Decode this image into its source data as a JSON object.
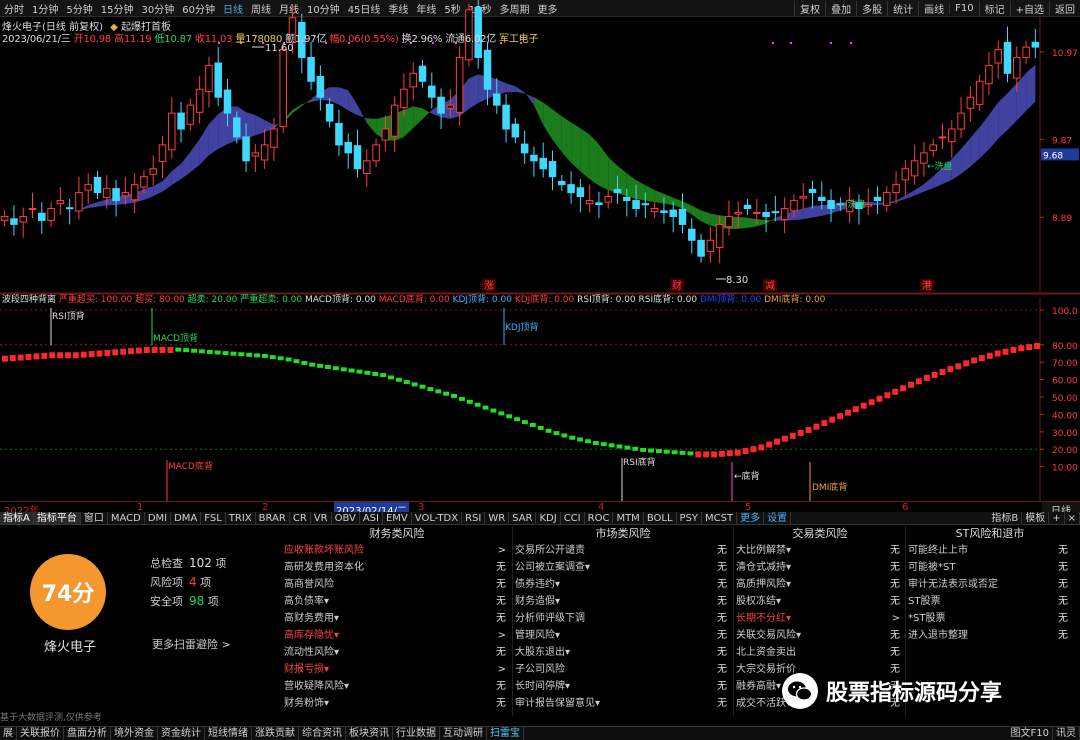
{
  "toolbar": {
    "periods": [
      "分时",
      "1分钟",
      "5分钟",
      "15分钟",
      "30分钟",
      "60分钟",
      "日线",
      "周线",
      "月线",
      "10分钟",
      "45日线",
      "季线",
      "年线",
      "5秒",
      "15秒",
      "多周期",
      "更多"
    ],
    "active_period": "日线",
    "right": [
      "复权",
      "叠加",
      "多股",
      "统计",
      "画线",
      "F10",
      "标记",
      "+自选",
      "返回"
    ]
  },
  "stock": {
    "name": "烽火电子(日线 前复权)",
    "tag": "起爆打首板",
    "date": "2023/06/21/三",
    "open_label": "开",
    "open": "10.98",
    "high_label": "高",
    "high": "11.19",
    "low_label": "低",
    "low": "10.87",
    "close_label": "收",
    "close": "11.03",
    "vol_label": "量",
    "vol": "178080",
    "amount_label": "额",
    "amount": "1.97亿",
    "change_label": "幅",
    "change": "0.06(0.55%)",
    "turn_label": "换",
    "turn": "2.96%",
    "float_label": "流通",
    "float": "6.02亿",
    "sector": "军工电子"
  },
  "price_axis": {
    "labels": [
      "10.97",
      "9.87",
      "8.89"
    ],
    "current": "9.68"
  },
  "chart_labels": {
    "high": "11.60",
    "low": "8.30",
    "wash1": "←洗盘",
    "wash2": "←洗盘"
  },
  "event_tags": [
    "涨",
    "财",
    "减",
    "港"
  ],
  "indicator": {
    "title": "波段四种背离",
    "items": [
      {
        "l": "严重超买:",
        "v": "100.00",
        "c": "#ff3c3c"
      },
      {
        "l": "超买:",
        "v": "80.00",
        "c": "#ff3c3c"
      },
      {
        "l": "超卖:",
        "v": "20.00",
        "c": "#20d860"
      },
      {
        "l": "严重超卖:",
        "v": "0.00",
        "c": "#20d860"
      },
      {
        "l": "MACD顶背:",
        "v": "0.00",
        "c": "#ddd"
      },
      {
        "l": "MACD底背:",
        "v": "0.00",
        "c": "#ff3c3c"
      },
      {
        "l": "KDJ顶背:",
        "v": "0.00",
        "c": "#40b0ff"
      },
      {
        "l": "KDJ底背:",
        "v": "0.00",
        "c": "#ff3c3c"
      },
      {
        "l": "RSI顶背:",
        "v": "0.00",
        "c": "#ddd"
      },
      {
        "l": "RSI底背:",
        "v": "0.00",
        "c": "#ddd"
      },
      {
        "l": "DMI顶背:",
        "v": "0.00",
        "c": "#2040ff"
      },
      {
        "l": "DMI底背:",
        "v": "0.00",
        "c": "#e8a040"
      }
    ],
    "axis": [
      "100.0",
      "80.00",
      "70.00",
      "60.00",
      "50.00",
      "40.00",
      "30.00",
      "20.00",
      "10.00"
    ],
    "labels": {
      "rsi_top": "RSI顶背",
      "macd_top": "MACD顶背",
      "kdj_top": "KDJ顶背",
      "macd_bot": "MACD底背",
      "rsi_bot": "RSI底背",
      "sup_bot": "←底背",
      "dmi_bot": "DMI底背"
    }
  },
  "dates": {
    "year": "2022年",
    "m2": "2",
    "m3": "3",
    "m4": "4",
    "m5": "5",
    "m6": "6",
    "m1": "1",
    "selected": "2023/02/14/二",
    "day": "日线"
  },
  "indtabs": [
    "指标A",
    "指标平台",
    "窗口",
    "MACD",
    "DMI",
    "DMA",
    "FSL",
    "TRIX",
    "BRAR",
    "CR",
    "VR",
    "OBV",
    "ASI",
    "EMV",
    "VOL-TDX",
    "RSI",
    "WR",
    "SAR",
    "KDJ",
    "CCI",
    "ROC",
    "MTM",
    "BOLL",
    "PSY",
    "MCST",
    "更多",
    "设置"
  ],
  "indtabs_right": [
    "指标B",
    "模板",
    "+",
    "×"
  ],
  "risk": {
    "score": "74分",
    "company": "烽火电子",
    "total_label": "总检查",
    "total": "102",
    "total_unit": "项",
    "risk_label": "风险项",
    "risk": "4",
    "risk_unit": "项",
    "safe_label": "安全项",
    "safe": "98",
    "safe_unit": "项",
    "more": "更多扫雷避险 >",
    "columns": [
      {
        "title": "财务类风险",
        "rows": [
          [
            "应收账款坏账风险",
            ">",
            1
          ],
          [
            "高研发费用资本化",
            "无",
            0
          ],
          [
            "高商誉风险",
            "无",
            0
          ],
          [
            "高负债率▾",
            "无",
            0
          ],
          [
            "高财务费用▾",
            "无",
            0
          ],
          [
            "高库存隐忧▾",
            ">",
            1
          ],
          [
            "流动性风险▾",
            "无",
            0
          ],
          [
            "财报亏损▾",
            ">",
            1
          ],
          [
            "营收疑降风险▾",
            "无",
            0
          ],
          [
            "财务粉饰▾",
            "无",
            0
          ]
        ]
      },
      {
        "title": "市场类风险",
        "rows": [
          [
            "交易所公开谴责",
            "无",
            0
          ],
          [
            "公司被立案调查▾",
            "无",
            0
          ],
          [
            "债券违约▾",
            "无",
            0
          ],
          [
            "财务造假▾",
            "无",
            0
          ],
          [
            "分析师评级下调",
            "无",
            0
          ],
          [
            "管理风险▾",
            "无",
            0
          ],
          [
            "大股东退出▾",
            "无",
            0
          ],
          [
            "子公司风险",
            "无",
            0
          ],
          [
            "长时间停牌▾",
            "无",
            0
          ],
          [
            "审计报告保留意见▾",
            "无",
            0
          ]
        ]
      },
      {
        "title": "交易类风险",
        "rows": [
          [
            "大比例解禁▾",
            "无",
            0
          ],
          [
            "清仓式减持▾",
            "无",
            0
          ],
          [
            "高质押风险▾",
            "无",
            0
          ],
          [
            "股权冻结▾",
            "无",
            0
          ],
          [
            "长期不分红▾",
            ">",
            1
          ],
          [
            "关联交易风险▾",
            "无",
            0
          ],
          [
            "北上资金卖出",
            "无",
            0
          ],
          [
            "大宗交易折价",
            "无",
            0
          ],
          [
            "融券高融▾",
            "无",
            0
          ],
          [
            "成交不活跃▾",
            "无",
            0
          ]
        ]
      },
      {
        "title": "ST风险和退市",
        "rows": [
          [
            "可能终止上市",
            "无",
            0
          ],
          [
            "可能被*ST",
            "无",
            0
          ],
          [
            "审计无法表示或否定",
            "无",
            0
          ],
          [
            "ST股票",
            "无",
            0
          ],
          [
            "*ST股票",
            "无",
            0
          ],
          [
            "进入退市整理",
            "无",
            0
          ]
        ]
      }
    ],
    "note": "基于大数据评测,仅供参考"
  },
  "bottom": {
    "tabs": [
      "展",
      "关联报价",
      "盘面分析",
      "境外资金",
      "资金统计",
      "短线情绪",
      "涨跌贡献",
      "综合资讯",
      "板块资讯",
      "行业数据",
      "互动调研",
      "扫雷宝"
    ],
    "active": "扫雷宝",
    "right": [
      "图文F10",
      "讯灵"
    ]
  },
  "watermark": "股票指标源码分享",
  "chart_data": {
    "type": "candlestick",
    "price_axis_labels": [
      10.97,
      9.87,
      8.89
    ],
    "current_price": 9.68,
    "period_high": 11.6,
    "period_low": 8.3,
    "indicator_ref_lines": [
      80,
      20
    ],
    "indicator_trend": [
      72,
      73,
      74,
      74,
      75,
      76,
      77,
      77,
      76,
      75,
      74,
      73,
      71,
      68,
      66,
      64,
      62,
      58,
      54,
      50,
      45,
      40,
      35,
      30,
      26,
      23,
      21,
      19,
      18,
      17,
      17,
      18,
      21,
      26,
      31,
      37,
      43,
      49,
      55,
      61,
      66,
      71,
      75,
      78,
      80
    ]
  }
}
